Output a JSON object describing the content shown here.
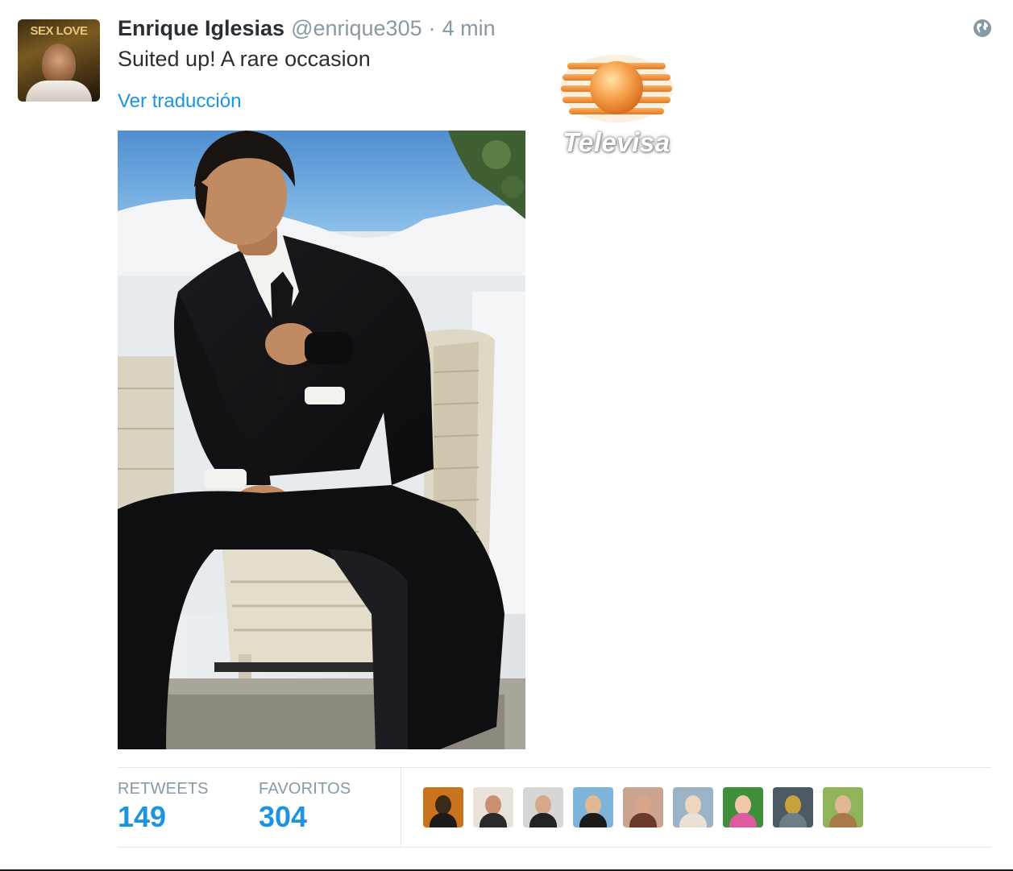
{
  "tweet": {
    "name": "Enrique Iglesias",
    "handle": "@enrique305",
    "separator": "·",
    "time": "4 min",
    "text": "Suited up! A rare occasion",
    "translate_link": "Ver traducción",
    "visibility_icon": "globe-icon"
  },
  "avatar": {
    "album_text": "SEX LOVE"
  },
  "watermark": {
    "text": "Televisa",
    "logo_icon": "televisa-logo"
  },
  "stats": {
    "retweets_label": "RETWEETS",
    "retweets_count": "149",
    "favorites_label": "FAVORITOS",
    "favorites_count": "304"
  },
  "favoriters": [
    {
      "label": "favoriter-1",
      "bg": "#c9731f",
      "skin": "#3b2a18",
      "shirt": "#1d1a1a"
    },
    {
      "label": "favoriter-2",
      "bg": "#e8e2da",
      "skin": "#c89070",
      "shirt": "#2a2a2a"
    },
    {
      "label": "favoriter-3",
      "bg": "#d6d6d6",
      "skin": "#d5a88a",
      "shirt": "#222222"
    },
    {
      "label": "favoriter-4",
      "bg": "#7eb4dc",
      "skin": "#e0b894",
      "shirt": "#1b1b1b"
    },
    {
      "label": "favoriter-5",
      "bg": "#caa48f",
      "skin": "#d9a58a",
      "shirt": "#6a3b2a"
    },
    {
      "label": "favoriter-6",
      "bg": "#9bb3c7",
      "skin": "#f0d6be",
      "shirt": "#e8e0d0"
    },
    {
      "label": "favoriter-7",
      "bg": "#3f8f3a",
      "skin": "#f0c8a8",
      "shirt": "#e05aa0"
    },
    {
      "label": "favoriter-8",
      "bg": "#4c5a64",
      "skin": "#c7a23a",
      "shirt": "#6f7d86"
    },
    {
      "label": "favoriter-9",
      "bg": "#8fb45a",
      "skin": "#e2b894",
      "shirt": "#a87a4a"
    }
  ],
  "colors": {
    "link_blue": "#1c94e0",
    "muted_gray": "#8899a6",
    "text_dark": "#292f33",
    "rule": "#e1e8ed"
  }
}
